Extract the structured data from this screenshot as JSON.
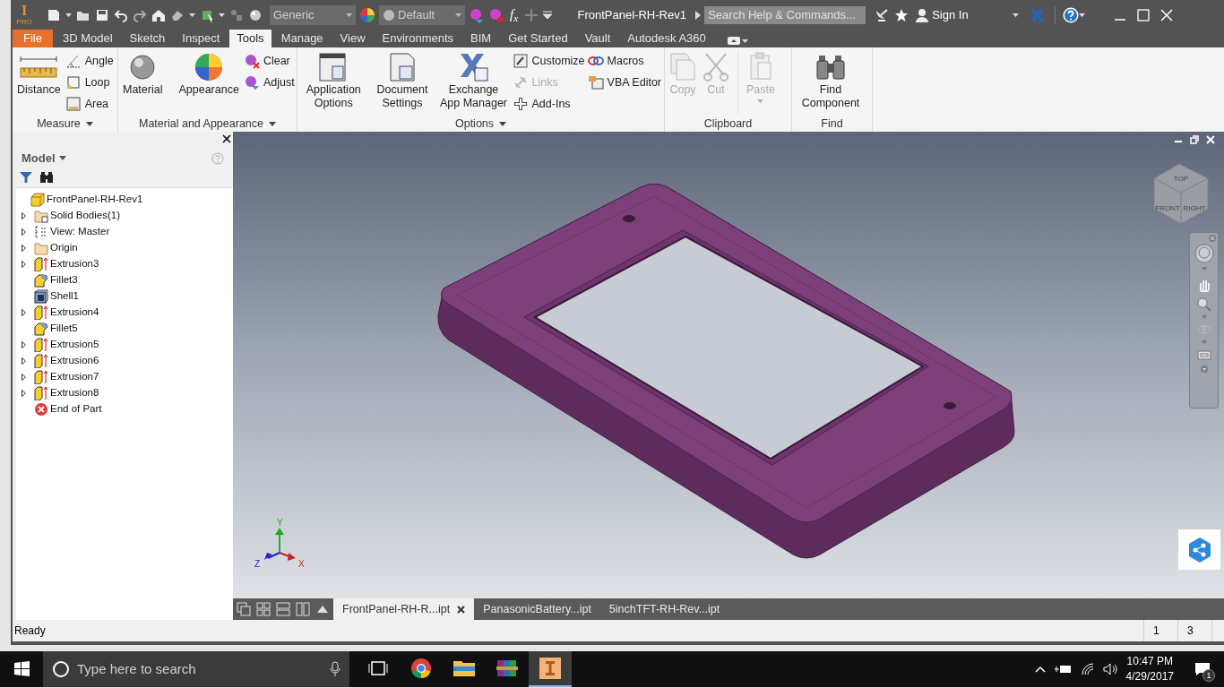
{
  "title_bar": {
    "logo": {
      "letter": "I",
      "edition": "PRO"
    },
    "material_dropdown": "Generic",
    "appearance_dropdown": "Default",
    "formula_symbol": "f",
    "formula_sub": "x",
    "title": "FrontPanel-RH-Rev1",
    "search": {
      "placeholder": "Search Help & Commands..."
    },
    "sign_in": "Sign In"
  },
  "file_menu": "File",
  "ribbon_tabs": [
    {
      "label": "3D Model",
      "selected": false
    },
    {
      "label": "Sketch",
      "selected": false
    },
    {
      "label": "Inspect",
      "selected": false
    },
    {
      "label": "Tools",
      "selected": true
    },
    {
      "label": "Manage",
      "selected": false
    },
    {
      "label": "View",
      "selected": false
    },
    {
      "label": "Environments",
      "selected": false
    },
    {
      "label": "BIM",
      "selected": false
    },
    {
      "label": "Get Started",
      "selected": false
    },
    {
      "label": "Vault",
      "selected": false
    },
    {
      "label": "Autodesk A360",
      "selected": false
    }
  ],
  "ribbon_groups": [
    {
      "title": "Measure",
      "has_menu": true,
      "items": [
        {
          "label": "Distance",
          "kind": "large",
          "disabled": false
        },
        {
          "label": "Angle",
          "kind": "small",
          "disabled": false
        },
        {
          "label": "Loop",
          "kind": "small",
          "disabled": false
        },
        {
          "label": "Area",
          "kind": "small",
          "disabled": false
        }
      ]
    },
    {
      "title": "Material and Appearance",
      "has_menu": true,
      "items": [
        {
          "label": "Material",
          "kind": "large",
          "disabled": false
        },
        {
          "label": "Appearance",
          "kind": "large",
          "disabled": false
        },
        {
          "label": "Clear",
          "kind": "small",
          "disabled": false
        },
        {
          "label": "Adjust",
          "kind": "small",
          "disabled": false
        }
      ]
    },
    {
      "title": "Options",
      "has_menu": true,
      "items": [
        {
          "label": "Application Options",
          "kind": "large",
          "disabled": false
        },
        {
          "label": "Document Settings",
          "kind": "large",
          "disabled": false
        },
        {
          "label": "Exchange App Manager",
          "kind": "large",
          "disabled": false
        },
        {
          "label": "Customize",
          "kind": "small",
          "disabled": false
        },
        {
          "label": "Links",
          "kind": "small",
          "disabled": true
        },
        {
          "label": "Add-Ins",
          "kind": "small",
          "disabled": false
        },
        {
          "label": "Macros",
          "kind": "small",
          "disabled": false
        },
        {
          "label": "VBA Editor",
          "kind": "small",
          "disabled": false
        }
      ]
    },
    {
      "title": "Clipboard",
      "has_menu": false,
      "items": [
        {
          "label": "Copy",
          "kind": "large",
          "disabled": true
        },
        {
          "label": "Cut",
          "kind": "large",
          "disabled": true
        },
        {
          "label": "Paste",
          "kind": "large",
          "disabled": true
        }
      ]
    },
    {
      "title": "Find",
      "has_menu": false,
      "items": [
        {
          "label": "Find Component",
          "kind": "large",
          "disabled": false
        }
      ]
    }
  ],
  "browser": {
    "title": "Model",
    "tree": [
      {
        "label": "FrontPanel-RH-Rev1",
        "kind": "part",
        "expandable": false,
        "children": [
          {
            "label": "Solid Bodies(1)",
            "kind": "bodies",
            "expandable": true
          },
          {
            "label": "View: Master",
            "kind": "view",
            "expandable": true
          },
          {
            "label": "Origin",
            "kind": "folder",
            "expandable": true
          },
          {
            "label": "Extrusion3",
            "kind": "extrusion",
            "expandable": true
          },
          {
            "label": "Fillet3",
            "kind": "fillet",
            "expandable": false
          },
          {
            "label": "Shell1",
            "kind": "shell",
            "expandable": false
          },
          {
            "label": "Extrusion4",
            "kind": "extrusion",
            "expandable": true
          },
          {
            "label": "Fillet5",
            "kind": "fillet",
            "expandable": false
          },
          {
            "label": "Extrusion5",
            "kind": "extrusion",
            "expandable": true
          },
          {
            "label": "Extrusion6",
            "kind": "extrusion",
            "expandable": true
          },
          {
            "label": "Extrusion7",
            "kind": "extrusion",
            "expandable": true
          },
          {
            "label": "Extrusion8",
            "kind": "extrusion",
            "expandable": true
          },
          {
            "label": "End of Part",
            "kind": "end",
            "expandable": false
          }
        ]
      }
    ]
  },
  "viewport": {
    "view_cube": {
      "top": "TOP",
      "front": "FRONT",
      "right": "RIGHT"
    },
    "axes": {
      "x": "X",
      "y": "Y",
      "z": "Z"
    }
  },
  "document_tabs": [
    {
      "label": "FrontPanel-RH-R...ipt",
      "selected": true
    },
    {
      "label": "PanasonicBattery...ipt",
      "selected": false
    },
    {
      "label": "5inchTFT-RH-Rev...ipt",
      "selected": false
    }
  ],
  "status_bar": {
    "message": "Ready",
    "cells": [
      "1",
      "3"
    ]
  },
  "taskbar": {
    "search": {
      "placeholder": "Type here to search"
    },
    "time": "10:47 PM",
    "date": "4/29/2017",
    "notifications": "1"
  }
}
